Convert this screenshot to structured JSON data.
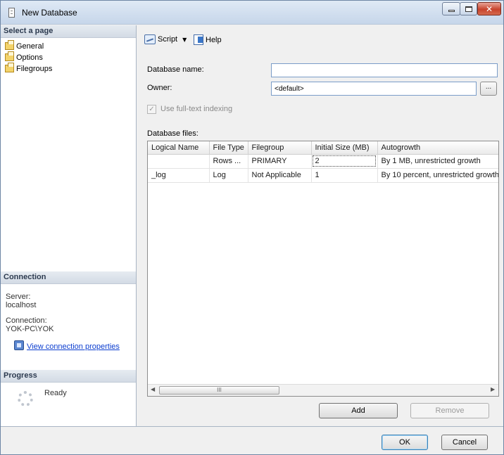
{
  "window": {
    "title": "New Database",
    "controls": [
      "minimize",
      "maximize",
      "close"
    ]
  },
  "left_pane": {
    "select_page": {
      "header": "Select a page",
      "items": [
        {
          "label": "General",
          "icon": "page-icon"
        },
        {
          "label": "Options",
          "icon": "page-icon"
        },
        {
          "label": "Filegroups",
          "icon": "page-icon"
        }
      ]
    },
    "connection": {
      "header": "Connection",
      "server_label": "Server:",
      "server_value": "localhost",
      "connection_label": "Connection:",
      "connection_value": "YOK-PC\\YOK",
      "link": "View connection properties"
    },
    "progress": {
      "header": "Progress",
      "status": "Ready"
    }
  },
  "toolbar": {
    "script_label": "Script",
    "help_label": "Help"
  },
  "form": {
    "database_name_label": "Database name:",
    "database_name_value": "",
    "owner_label": "Owner:",
    "owner_value": "<default>",
    "browse_label": "...",
    "fulltext_label": "Use full-text indexing",
    "fulltext_checked": true,
    "files_label": "Database files:"
  },
  "grid": {
    "columns": [
      "Logical Name",
      "File Type",
      "Filegroup",
      "Initial Size (MB)",
      "Autogrowth"
    ],
    "rows": [
      [
        "",
        "Rows ...",
        "PRIMARY",
        "2",
        "By 1 MB, unrestricted growth"
      ],
      [
        "_log",
        "Log",
        "Not Applicable",
        "1",
        "By 10 percent, unrestricted growth"
      ]
    ],
    "scrollbar_thumb": "III"
  },
  "buttons": {
    "add": "Add",
    "remove": "Remove",
    "ok": "OK",
    "cancel": "Cancel"
  },
  "colors": {
    "link": "#0b3dcf",
    "close_button": "#c7432c",
    "header_bg": "#d3dbe5"
  }
}
